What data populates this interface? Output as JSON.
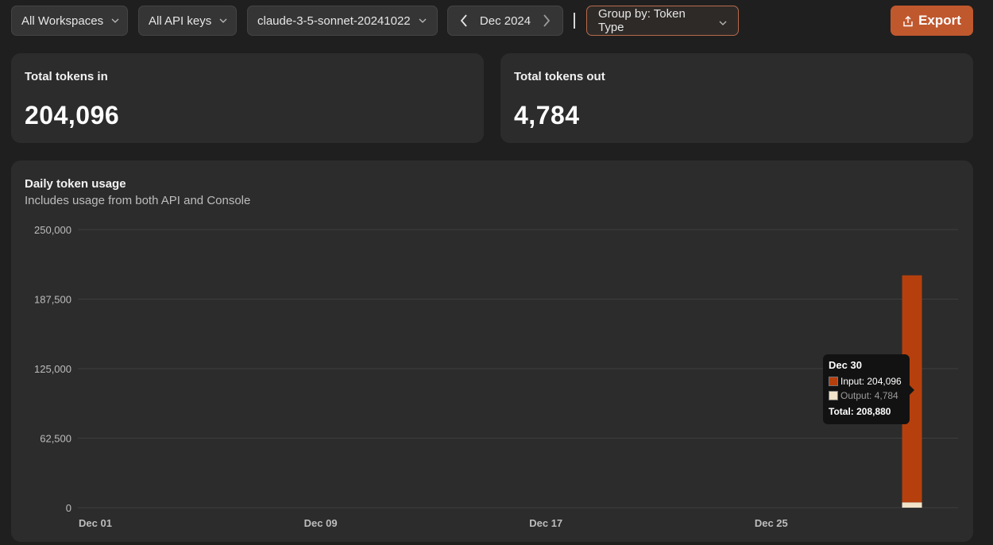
{
  "toolbar": {
    "workspaces": "All Workspaces",
    "api_keys": "All API keys",
    "model": "claude-3-5-sonnet-20241022",
    "month": "Dec 2024",
    "group_by": "Group by: Token Type",
    "export": "Export"
  },
  "stats": {
    "tokens_in_label": "Total tokens in",
    "tokens_in_value": "204,096",
    "tokens_out_label": "Total tokens out",
    "tokens_out_value": "4,784"
  },
  "colors": {
    "input": "#b5400d",
    "output": "#f0e3c9",
    "accent": "#c0582e"
  },
  "chart_data": {
    "type": "bar",
    "stacked": true,
    "title": "Daily token usage",
    "subtitle": "Includes usage from both API and Console",
    "ylim": [
      0,
      250000
    ],
    "yticks": [
      "250,000",
      "187,500",
      "125,000",
      "62,500",
      "0"
    ],
    "ytick_values": [
      250000,
      187500,
      125000,
      62500,
      0
    ],
    "xticks": [
      "Dec 01",
      "Dec 09",
      "Dec 17",
      "Dec 25"
    ],
    "xtick_days": [
      1,
      9,
      17,
      25
    ],
    "days": 31,
    "series": [
      {
        "name": "Input",
        "points": [
          {
            "day": 30,
            "value": 204096
          }
        ]
      },
      {
        "name": "Output",
        "points": [
          {
            "day": 30,
            "value": 4784
          }
        ]
      }
    ],
    "tooltip": {
      "date": "Dec 30",
      "input": "Input: 204,096",
      "output": "Output: 4,784",
      "total": "Total: 208,880"
    }
  }
}
